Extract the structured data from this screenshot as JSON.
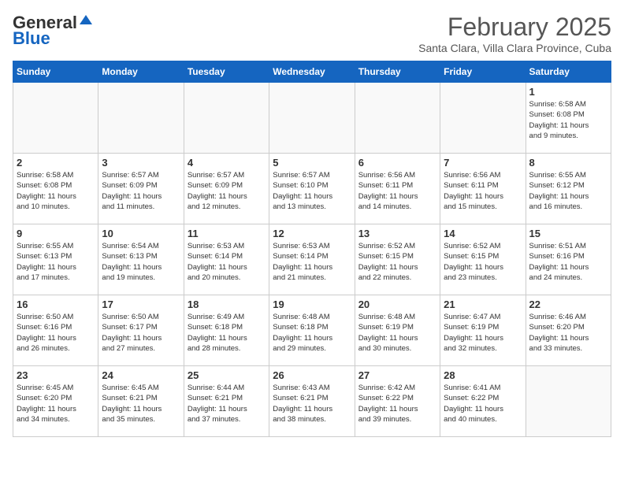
{
  "header": {
    "logo_general": "General",
    "logo_blue": "Blue",
    "month_title": "February 2025",
    "location": "Santa Clara, Villa Clara Province, Cuba"
  },
  "weekdays": [
    "Sunday",
    "Monday",
    "Tuesday",
    "Wednesday",
    "Thursday",
    "Friday",
    "Saturday"
  ],
  "weeks": [
    [
      {
        "day": "",
        "info": ""
      },
      {
        "day": "",
        "info": ""
      },
      {
        "day": "",
        "info": ""
      },
      {
        "day": "",
        "info": ""
      },
      {
        "day": "",
        "info": ""
      },
      {
        "day": "",
        "info": ""
      },
      {
        "day": "1",
        "info": "Sunrise: 6:58 AM\nSunset: 6:08 PM\nDaylight: 11 hours\nand 9 minutes."
      }
    ],
    [
      {
        "day": "2",
        "info": "Sunrise: 6:58 AM\nSunset: 6:08 PM\nDaylight: 11 hours\nand 10 minutes."
      },
      {
        "day": "3",
        "info": "Sunrise: 6:57 AM\nSunset: 6:09 PM\nDaylight: 11 hours\nand 11 minutes."
      },
      {
        "day": "4",
        "info": "Sunrise: 6:57 AM\nSunset: 6:09 PM\nDaylight: 11 hours\nand 12 minutes."
      },
      {
        "day": "5",
        "info": "Sunrise: 6:57 AM\nSunset: 6:10 PM\nDaylight: 11 hours\nand 13 minutes."
      },
      {
        "day": "6",
        "info": "Sunrise: 6:56 AM\nSunset: 6:11 PM\nDaylight: 11 hours\nand 14 minutes."
      },
      {
        "day": "7",
        "info": "Sunrise: 6:56 AM\nSunset: 6:11 PM\nDaylight: 11 hours\nand 15 minutes."
      },
      {
        "day": "8",
        "info": "Sunrise: 6:55 AM\nSunset: 6:12 PM\nDaylight: 11 hours\nand 16 minutes."
      }
    ],
    [
      {
        "day": "9",
        "info": "Sunrise: 6:55 AM\nSunset: 6:13 PM\nDaylight: 11 hours\nand 17 minutes."
      },
      {
        "day": "10",
        "info": "Sunrise: 6:54 AM\nSunset: 6:13 PM\nDaylight: 11 hours\nand 19 minutes."
      },
      {
        "day": "11",
        "info": "Sunrise: 6:53 AM\nSunset: 6:14 PM\nDaylight: 11 hours\nand 20 minutes."
      },
      {
        "day": "12",
        "info": "Sunrise: 6:53 AM\nSunset: 6:14 PM\nDaylight: 11 hours\nand 21 minutes."
      },
      {
        "day": "13",
        "info": "Sunrise: 6:52 AM\nSunset: 6:15 PM\nDaylight: 11 hours\nand 22 minutes."
      },
      {
        "day": "14",
        "info": "Sunrise: 6:52 AM\nSunset: 6:15 PM\nDaylight: 11 hours\nand 23 minutes."
      },
      {
        "day": "15",
        "info": "Sunrise: 6:51 AM\nSunset: 6:16 PM\nDaylight: 11 hours\nand 24 minutes."
      }
    ],
    [
      {
        "day": "16",
        "info": "Sunrise: 6:50 AM\nSunset: 6:16 PM\nDaylight: 11 hours\nand 26 minutes."
      },
      {
        "day": "17",
        "info": "Sunrise: 6:50 AM\nSunset: 6:17 PM\nDaylight: 11 hours\nand 27 minutes."
      },
      {
        "day": "18",
        "info": "Sunrise: 6:49 AM\nSunset: 6:18 PM\nDaylight: 11 hours\nand 28 minutes."
      },
      {
        "day": "19",
        "info": "Sunrise: 6:48 AM\nSunset: 6:18 PM\nDaylight: 11 hours\nand 29 minutes."
      },
      {
        "day": "20",
        "info": "Sunrise: 6:48 AM\nSunset: 6:19 PM\nDaylight: 11 hours\nand 30 minutes."
      },
      {
        "day": "21",
        "info": "Sunrise: 6:47 AM\nSunset: 6:19 PM\nDaylight: 11 hours\nand 32 minutes."
      },
      {
        "day": "22",
        "info": "Sunrise: 6:46 AM\nSunset: 6:20 PM\nDaylight: 11 hours\nand 33 minutes."
      }
    ],
    [
      {
        "day": "23",
        "info": "Sunrise: 6:45 AM\nSunset: 6:20 PM\nDaylight: 11 hours\nand 34 minutes."
      },
      {
        "day": "24",
        "info": "Sunrise: 6:45 AM\nSunset: 6:21 PM\nDaylight: 11 hours\nand 35 minutes."
      },
      {
        "day": "25",
        "info": "Sunrise: 6:44 AM\nSunset: 6:21 PM\nDaylight: 11 hours\nand 37 minutes."
      },
      {
        "day": "26",
        "info": "Sunrise: 6:43 AM\nSunset: 6:21 PM\nDaylight: 11 hours\nand 38 minutes."
      },
      {
        "day": "27",
        "info": "Sunrise: 6:42 AM\nSunset: 6:22 PM\nDaylight: 11 hours\nand 39 minutes."
      },
      {
        "day": "28",
        "info": "Sunrise: 6:41 AM\nSunset: 6:22 PM\nDaylight: 11 hours\nand 40 minutes."
      },
      {
        "day": "",
        "info": ""
      }
    ]
  ]
}
